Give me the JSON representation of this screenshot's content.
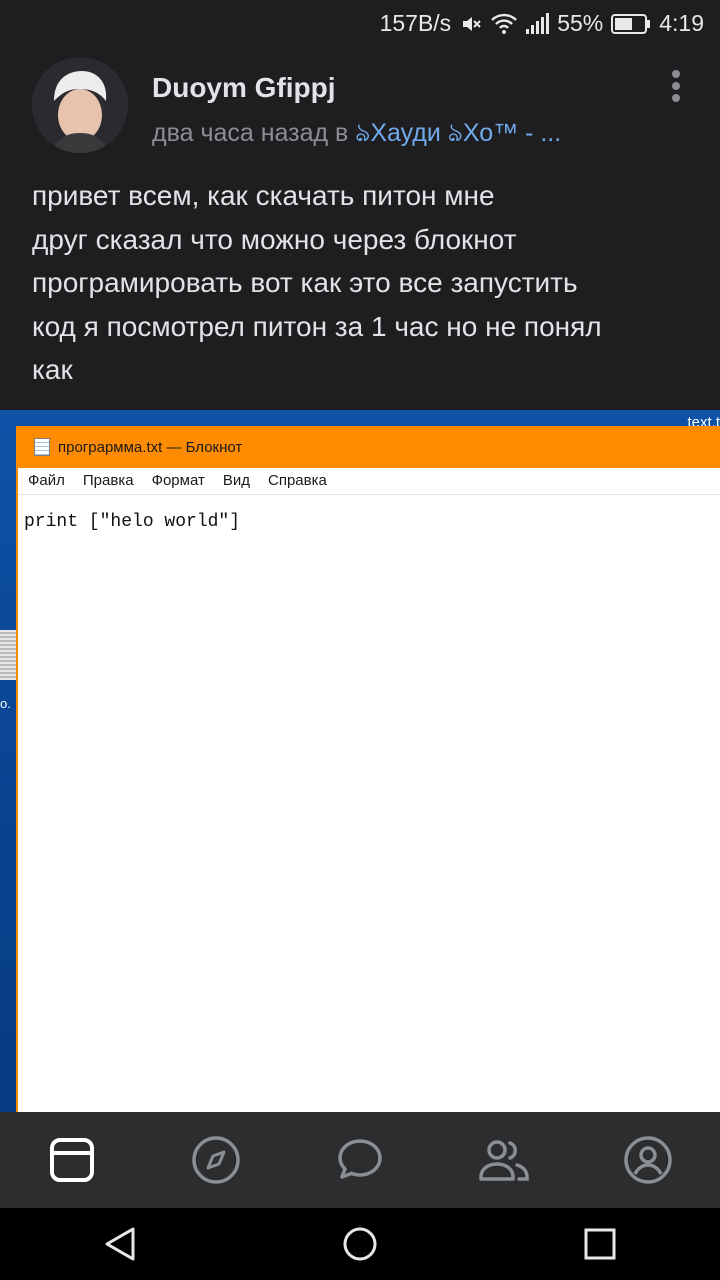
{
  "status_bar": {
    "speed": "157B/s",
    "battery": "55%",
    "time": "4:19"
  },
  "post": {
    "author": "Duoym Gfippj",
    "time_ago": "два часа назад в ",
    "group": "ঌХауди ঌХо™ - ...",
    "text_lines": [
      "привет всем, как скачать питон мне",
      "друг сказал что можно через блокнот",
      "програмировать вот как это все запустить",
      "код я посмотрел питон за 1 час но не понял",
      "как"
    ]
  },
  "photo": {
    "desktop_label": "text.t",
    "desktop_icon_label": "о.",
    "notepad_title": "програрмма.txt — Блокнот",
    "notepad_menu": [
      "Файл",
      "Правка",
      "Формат",
      "Вид",
      "Справка"
    ],
    "notepad_content": "print [\"helo world\"]"
  },
  "tabs": [
    {
      "icon": "news-icon",
      "active": true
    },
    {
      "icon": "discover-icon",
      "active": false
    },
    {
      "icon": "messages-icon",
      "active": false
    },
    {
      "icon": "friends-icon",
      "active": false
    },
    {
      "icon": "profile-icon",
      "active": false
    }
  ],
  "nav": [
    "back-icon",
    "home-icon",
    "recents-icon"
  ],
  "colors": {
    "background": "#1e1e20",
    "link": "#71aaeb",
    "notepad_titlebar": "#ff8c00",
    "tabbar": "#2c2d2f"
  }
}
